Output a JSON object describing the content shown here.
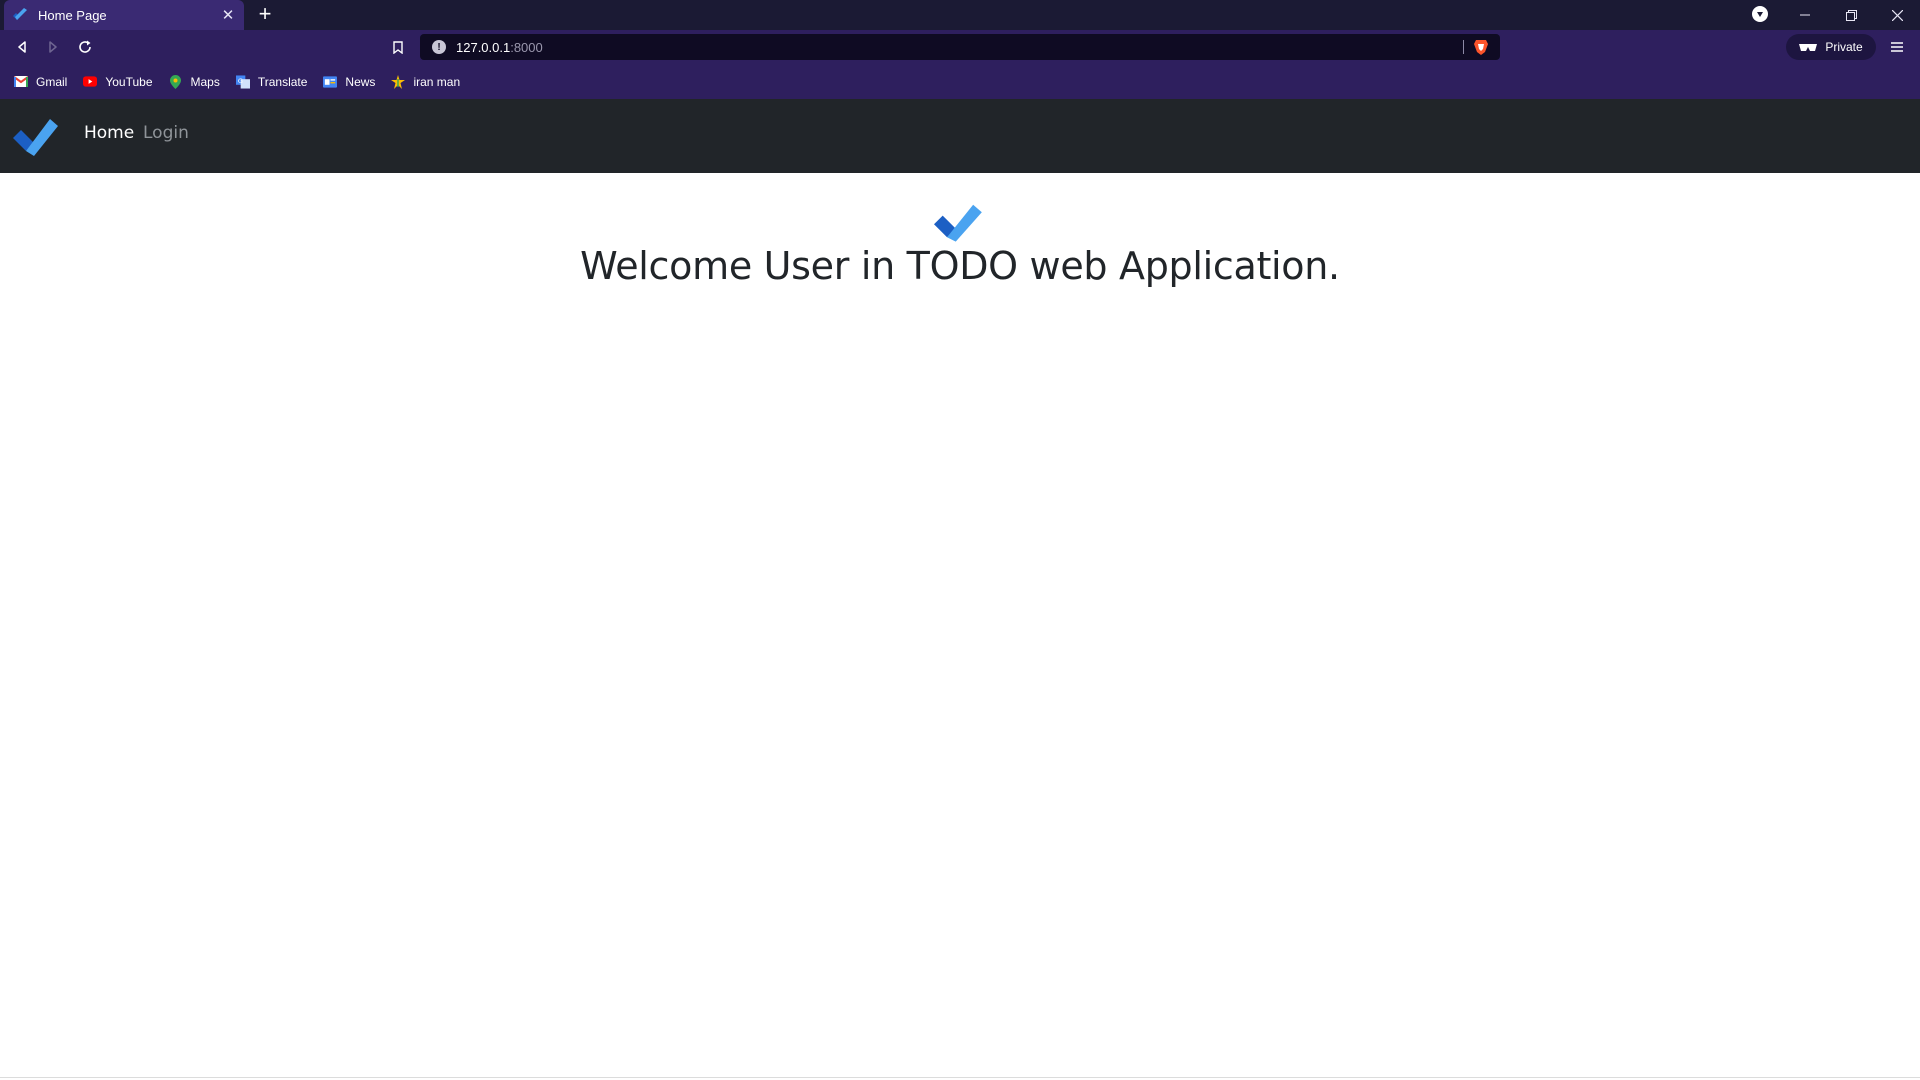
{
  "browser": {
    "tab": {
      "title": "Home Page"
    },
    "address": {
      "host": "127.0.0.1",
      "port": ":8000"
    },
    "private_label": "Private",
    "bookmarks": [
      {
        "label": "Gmail",
        "icon": "gmail-icon"
      },
      {
        "label": "YouTube",
        "icon": "youtube-icon"
      },
      {
        "label": "Maps",
        "icon": "maps-icon"
      },
      {
        "label": "Translate",
        "icon": "translate-icon"
      },
      {
        "label": "News",
        "icon": "news-icon"
      },
      {
        "label": "iran man",
        "icon": "bookmark-star-icon"
      }
    ]
  },
  "site": {
    "nav": {
      "home": "Home",
      "login": "Login"
    },
    "hero": {
      "title": "Welcome User in TODO web Application."
    }
  },
  "colors": {
    "chrome_dark": "#1b1a34",
    "chrome_purple": "#2e1f5e",
    "site_nav": "#212529",
    "check_light": "#4aa3f0",
    "check_dark": "#1c5fc4"
  }
}
